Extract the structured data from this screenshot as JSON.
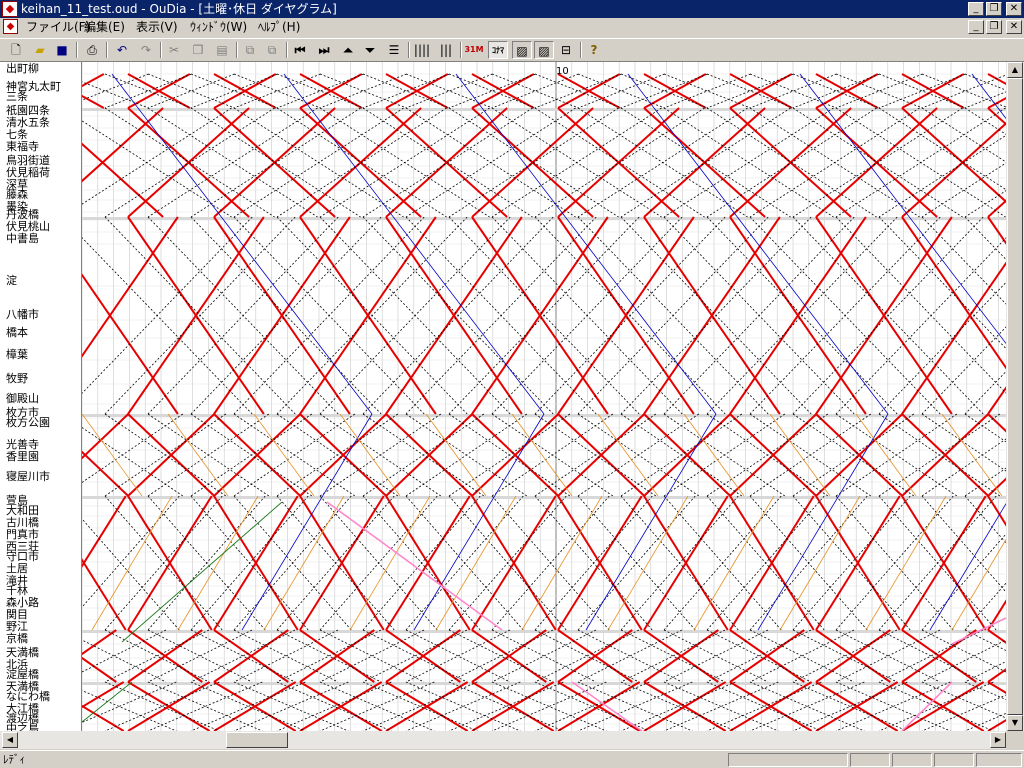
{
  "window": {
    "title": "keihan_11_test.oud - OuDia - [土曜･休日 ダイヤグラム]",
    "app_icon": "oudia-app-icon",
    "controls": [
      "minimize",
      "restore",
      "close"
    ]
  },
  "menubar": {
    "items": [
      "ファイル(F)",
      "編集(E)",
      "表示(V)",
      "ｳｨﾝﾄﾞｳ(W)",
      "ﾍﾙﾌﾟ(H)"
    ]
  },
  "toolbar": {
    "buttons": [
      "new-file",
      "open",
      "save",
      "print",
      "undo",
      "redo",
      "cut",
      "copy",
      "paste",
      "view-a",
      "view-b",
      "first",
      "last",
      "go-top",
      "go-bottom",
      "align",
      "vlines-a",
      "vlines-b",
      "toggle-31m",
      "toggle-kotsu",
      "diagram-a",
      "diagram-b",
      "diagram-c",
      "help"
    ],
    "labels": {
      "btn_31m": "31M",
      "btn_kotsu": "ｺﾅﾏ"
    }
  },
  "diagram": {
    "hour_label": "10",
    "stations": [
      "出町柳",
      "神宮丸太町",
      "三条",
      "祇園四条",
      "清水五条",
      "七条",
      "東福寺",
      "鳥羽街道",
      "伏見稲荷",
      "深草",
      "藤森",
      "墨染",
      "丹波橋",
      "伏見桃山",
      "中書島",
      "淀",
      "八幡市",
      "橋本",
      "樟葉",
      "牧野",
      "御殿山",
      "枚方市",
      "枚方公園",
      "光善寺",
      "香里園",
      "寝屋川市",
      "萱島",
      "大和田",
      "古川橋",
      "門真市",
      "西三荘",
      "守口市",
      "土居",
      "滝井",
      "千林",
      "森小路",
      "関目",
      "野江",
      "京橋",
      "天満橋",
      "北浜",
      "淀屋橋",
      "天満橋",
      "なにわ橋",
      "大江橋",
      "渡辺橋",
      "中之島"
    ],
    "colors": {
      "limited_express": "#e60000",
      "express": "#0000c8",
      "semi_express": "#e89020",
      "local": "#000000",
      "special": "#ff88cc",
      "other": "#1a7a1a"
    }
  },
  "status": {
    "text": "ﾚﾃﾞｨ"
  }
}
